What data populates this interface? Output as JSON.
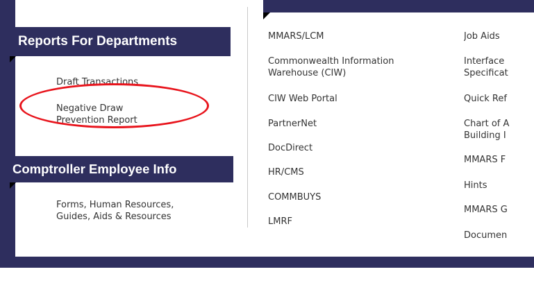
{
  "reports_header": "Reports For Departments",
  "reports_links": [
    "Draft Transactions",
    "Negative Draw\nPrevention Report"
  ],
  "comptroller_header": "Comptroller Employee Info",
  "comptroller_link": "Forms, Human Resources,\nGuides, Aids & Resources",
  "systems_col1": [
    "MMARS/LCM",
    "Commonwealth Information\nWarehouse (CIW)",
    "CIW Web Portal",
    "PartnerNet",
    "DocDirect",
    "HR/CMS",
    "COMMBUYS",
    "LMRF"
  ],
  "systems_col2": [
    "Job Aids",
    "Interface\nSpecificat",
    "Quick Ref",
    "Chart of A\nBuilding I",
    "MMARS F",
    "Hints",
    "MMARS G",
    "Documen"
  ],
  "colors": {
    "navy": "#2e2e5e",
    "annotation_red": "#e8141c",
    "link_text": "#333333"
  },
  "annotation": "red ellipse highlighting Negative Draw Prevention Report"
}
